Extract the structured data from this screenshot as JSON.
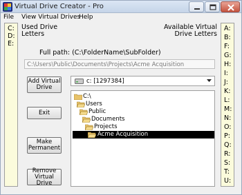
{
  "window": {
    "title": "Virtual Drive Creator - Pro"
  },
  "menu": {
    "items": [
      "File",
      "View Virtual Drives",
      "Help"
    ]
  },
  "used_panel": {
    "label": "Used Drive Letters",
    "letters": [
      "C:",
      "D:",
      "E:"
    ]
  },
  "available_panel": {
    "label": "Available Virtual Drive Letters",
    "letters": [
      "A:",
      "B:",
      "F:",
      "G:",
      "H:",
      "I:",
      "J:",
      "K:",
      "L:",
      "M:",
      "N:",
      "O:",
      "P:",
      "Q:",
      "R:",
      "S:",
      "T:",
      "U:"
    ]
  },
  "path": {
    "label": "Full path: (C:\\FolderName\\SubFolder)",
    "value": "C:\\Users\\Public\\Documents\\Projects\\Acme Acquisition"
  },
  "buttons": {
    "add": "Add Virtual Drive",
    "exit": "Exit",
    "permanent": "Make Permanent",
    "remove": "Remove Virtual Drive"
  },
  "drive_select": {
    "value": "c: [1297384]"
  },
  "folder_tree": [
    {
      "label": "C:\\",
      "selected": false
    },
    {
      "label": "Users",
      "selected": false
    },
    {
      "label": "Public",
      "selected": false
    },
    {
      "label": "Documents",
      "selected": false
    },
    {
      "label": "Projects",
      "selected": false
    },
    {
      "label": "Acme Acquisition",
      "selected": true
    }
  ],
  "icons": {
    "app": "app-icon",
    "drive": "hard-drive-icon",
    "folder": "folder-icon",
    "open_folder": "folder-open-icon"
  },
  "colors": {
    "letters_bg": "#fbfbdc",
    "selection": "#000000",
    "folder": "#e8c36a"
  }
}
